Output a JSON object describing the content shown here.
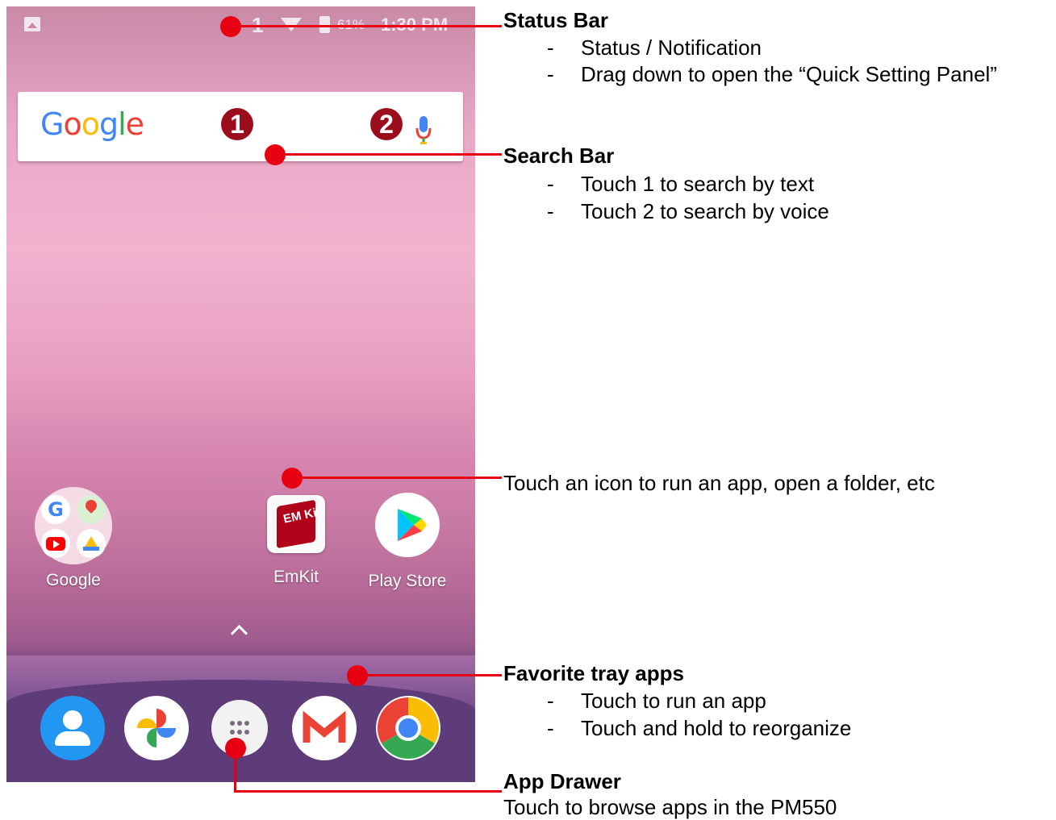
{
  "status_bar": {
    "sim": "1",
    "battery": "61%",
    "time": "1:30 PM"
  },
  "search_bar": {
    "logo": "Google",
    "badge1": "1",
    "badge2": "2"
  },
  "apps": [
    {
      "label": "Google"
    },
    {
      "label": "EmKit"
    },
    {
      "label": "Play Store"
    }
  ],
  "emkit_logo": "EM Kit",
  "dock_icons": [
    "contacts-icon",
    "photos-icon",
    "app-drawer-icon",
    "gmail-icon",
    "chrome-icon"
  ],
  "callouts": {
    "status_bar": {
      "title": "Status Bar",
      "bullets": [
        "Status / Notification",
        "Drag down to open the “Quick Setting Panel”"
      ]
    },
    "search_bar": {
      "title": "Search Bar",
      "bullets": [
        "Touch 1 to search by text",
        "Touch 2 to search by voice"
      ]
    },
    "icons": {
      "text": "Touch an icon to run an app, open a folder, etc"
    },
    "favorite_tray": {
      "title": "Favorite tray apps",
      "bullets": [
        "Touch to run an app",
        "Touch and hold to reorganize"
      ]
    },
    "app_drawer": {
      "title": "App Drawer",
      "text": "Touch to browse apps in the PM550"
    }
  },
  "colors": {
    "callout_red": "#e60012",
    "badge_red": "#9b0d1c"
  }
}
